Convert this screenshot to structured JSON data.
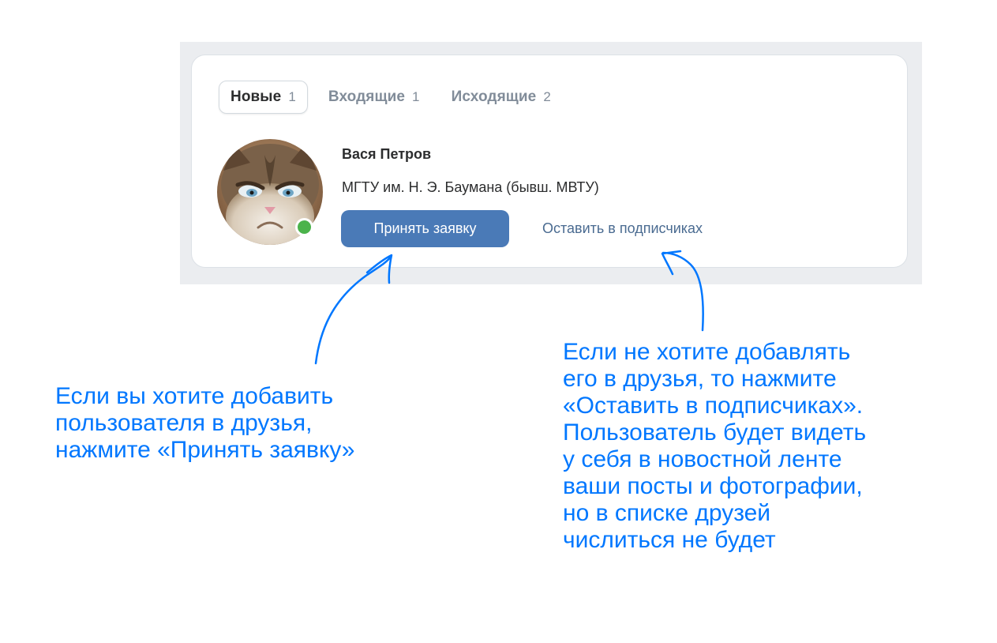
{
  "tabs": [
    {
      "label": "Новые",
      "count": "1",
      "active": true
    },
    {
      "label": "Входящие",
      "count": "1",
      "active": false
    },
    {
      "label": "Исходящие",
      "count": "2",
      "active": false
    }
  ],
  "request": {
    "name": "Вася Петров",
    "info": "МГТУ им. Н. Э. Баумана (бывш. МВТУ)",
    "avatar_icon": "grumpy-cat-avatar",
    "online": true,
    "accept_label": "Принять заявку",
    "keep_subscriber_label": "Оставить в подписчиках"
  },
  "captions": {
    "left": [
      "Если вы хотите добавить",
      "пользователя в друзья,",
      "нажмите «Принять заявку»"
    ],
    "right": [
      "Если не хотите добавлять",
      "его в друзья, то нажмите",
      "«Оставить в подписчиках».",
      "Пользователь будет видеть",
      "у себя в новостной ленте",
      "ваши посты и фотографии,",
      "но в списке друзей",
      "числиться не будет"
    ]
  },
  "colors": {
    "accent": "#0077ff",
    "button": "#4a7ab7",
    "link": "#4a6b91",
    "online": "#4bb34b",
    "frame_bg": "#ebedf0"
  }
}
